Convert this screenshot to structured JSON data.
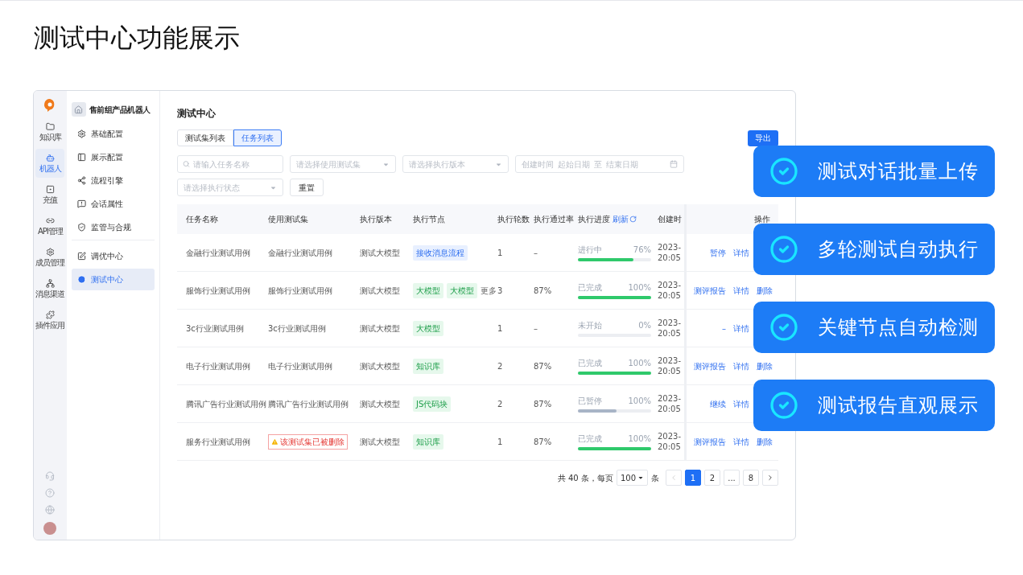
{
  "slide_title": "测试中心功能展示",
  "rail": {
    "items": [
      {
        "label": "知识库",
        "selected": false
      },
      {
        "label": "机器人",
        "selected": true
      },
      {
        "label": "充值",
        "selected": false
      },
      {
        "label": "API管理",
        "selected": false
      },
      {
        "label": "成员管理",
        "selected": false
      },
      {
        "label": "消息渠道",
        "selected": false
      },
      {
        "label": "插件应用",
        "selected": false
      }
    ]
  },
  "sidebar": {
    "title": "售前组产品机器人",
    "groups": [
      [
        {
          "label": "基础配置",
          "selected": false
        },
        {
          "label": "展示配置",
          "selected": false
        },
        {
          "label": "流程引擎",
          "selected": false
        },
        {
          "label": "会话属性",
          "selected": false
        },
        {
          "label": "监管与合规",
          "selected": false
        }
      ],
      [
        {
          "label": "调优中心",
          "selected": false
        },
        {
          "label": "测试中心",
          "selected": true
        }
      ]
    ]
  },
  "page_title": "测试中心",
  "tabs": [
    {
      "label": "测试集列表",
      "selected": false
    },
    {
      "label": "任务列表",
      "selected": true
    }
  ],
  "export_button": "导出",
  "filters": {
    "search": {
      "placeholder": "请输入任务名称"
    },
    "selects": [
      {
        "placeholder": "请选择使用测试集"
      },
      {
        "placeholder": "请选择执行版本"
      }
    ],
    "date_range": {
      "label": "创建时间",
      "start": "起始日期",
      "separator": "至",
      "end": "结束日期"
    },
    "status_select": {
      "placeholder": "请选择执行状态"
    },
    "reset_button": "重置"
  },
  "table": {
    "columns": [
      "任务名称",
      "使用测试集",
      "执行版本",
      "执行节点",
      "执行轮数",
      "执行通过率",
      "执行进度",
      "创建时",
      "操作"
    ],
    "refresh_link": "刷新",
    "rows": [
      {
        "name": "金融行业测试用例",
        "dataset": {
          "text": "金融行业测试用例",
          "deleted": false
        },
        "version": "测试大模型",
        "nodes": [
          {
            "text": "接收消息流程",
            "kind": "blue"
          }
        ],
        "rounds": "1",
        "pass_rate": "–",
        "progress": {
          "status": "进行中",
          "percent": "76%",
          "level": 0.76,
          "paused": false
        },
        "created": [
          "2023-",
          "20:05"
        ],
        "actions": [
          "暂停",
          "详情"
        ]
      },
      {
        "name": "服饰行业测试用例",
        "dataset": {
          "text": "服饰行业测试用例",
          "deleted": false
        },
        "version": "测试大模型",
        "nodes": [
          {
            "text": "大模型",
            "kind": "green"
          },
          {
            "text": "大模型",
            "kind": "green"
          }
        ],
        "more": "更多",
        "rounds": "3",
        "pass_rate": "87%",
        "progress": {
          "status": "已完成",
          "percent": "100%",
          "level": 1,
          "paused": false
        },
        "created": [
          "2023-",
          "20:05"
        ],
        "actions": [
          "测评报告",
          "详情",
          "删除"
        ]
      },
      {
        "name": "3c行业测试用例",
        "dataset": {
          "text": "3c行业测试用例",
          "deleted": false
        },
        "version": "测试大模型",
        "nodes": [
          {
            "text": "大模型",
            "kind": "green"
          }
        ],
        "rounds": "1",
        "pass_rate": "–",
        "progress": {
          "status": "未开始",
          "percent": "0%",
          "level": 0
        },
        "created": [
          "2023-",
          "20:05"
        ],
        "actions": [
          "–",
          "详情"
        ]
      },
      {
        "name": "电子行业测试用例",
        "dataset": {
          "text": "电子行业测试用例",
          "deleted": false
        },
        "version": "测试大模型",
        "nodes": [
          {
            "text": "知识库",
            "kind": "green"
          }
        ],
        "rounds": "2",
        "pass_rate": "87%",
        "progress": {
          "status": "已完成",
          "percent": "100%",
          "level": 1,
          "paused": false
        },
        "created": [
          "2023-",
          "20:05"
        ],
        "actions": [
          "测评报告",
          "详情",
          "删除"
        ]
      },
      {
        "name": "腾讯广告行业测试用例",
        "dataset": {
          "text": "腾讯广告行业测试用例",
          "deleted": false
        },
        "version": "测试大模型",
        "nodes": [
          {
            "text": "JS代码块",
            "kind": "green"
          }
        ],
        "rounds": "2",
        "pass_rate": "87%",
        "progress": {
          "status": "已暂停",
          "percent": "100%",
          "level": 0.53,
          "paused": true
        },
        "created": [
          "2023-",
          "20:05"
        ],
        "actions": [
          "继续",
          "详情"
        ]
      },
      {
        "name": "服务行业测试用例",
        "dataset": {
          "text": "该测试集已被删除",
          "deleted": true
        },
        "version": "测试大模型",
        "nodes": [
          {
            "text": "知识库",
            "kind": "green"
          }
        ],
        "rounds": "1",
        "pass_rate": "87%",
        "progress": {
          "status": "已完成",
          "percent": "100%",
          "level": 1,
          "paused": false
        },
        "created": [
          "2023-",
          "20:05"
        ],
        "actions": [
          "测评报告",
          "详情",
          "删除"
        ]
      }
    ]
  },
  "pagination": {
    "total": "共 40 条，每页",
    "page_size": "100",
    "unit": "条",
    "pages": [
      {
        "label": "1",
        "selected": true
      },
      {
        "label": "2",
        "selected": false
      },
      {
        "label": "...",
        "selected": false
      },
      {
        "label": "8",
        "selected": false
      }
    ]
  },
  "callouts": [
    "测试对话批量上传",
    "多轮测试自动执行",
    "关键节点自动检测",
    "测试报告直观展示"
  ]
}
